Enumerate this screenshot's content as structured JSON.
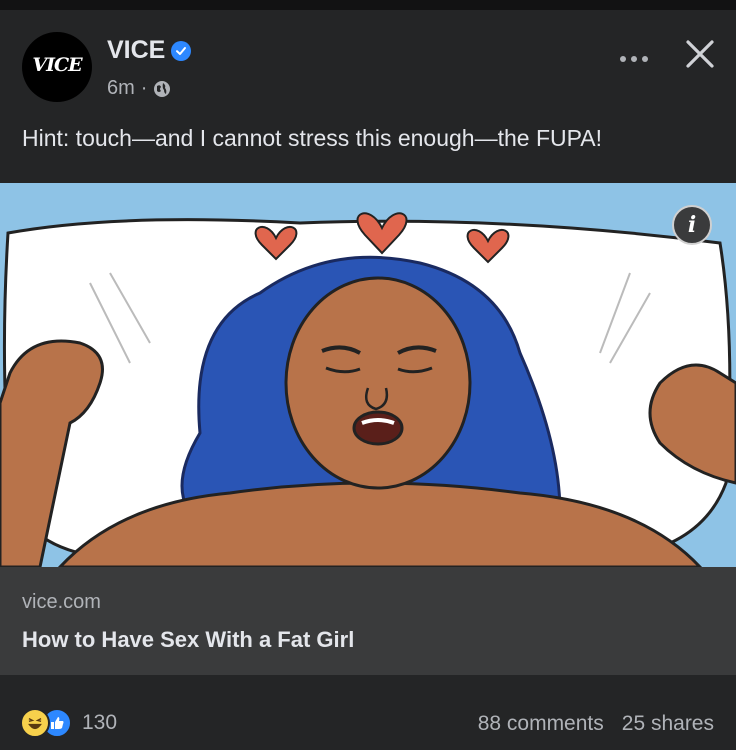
{
  "post": {
    "page_name": "VICE",
    "avatar_text": "VICE",
    "time_ago": "6m",
    "separator": "·",
    "caption": "Hint: touch—and I cannot stress this enough—the FUPA!",
    "info_glyph": "i",
    "verified_icon": "verified-badge-icon",
    "privacy_icon": "globe-icon"
  },
  "link_preview": {
    "domain": "vice.com",
    "headline": "How to Have Sex With a Fat Girl"
  },
  "engagement": {
    "reaction_count": "130",
    "comments": "88 comments",
    "shares": "25 shares",
    "reactions": [
      "haha",
      "like"
    ]
  },
  "colors": {
    "background": "#242526",
    "preview_bg": "#3a3b3c",
    "accent_blue": "#2d88ff",
    "illustration_sky": "#8ec3e6",
    "hair_blue": "#2a55b5",
    "skin": "#b8734a",
    "heart": "#e0664e"
  }
}
